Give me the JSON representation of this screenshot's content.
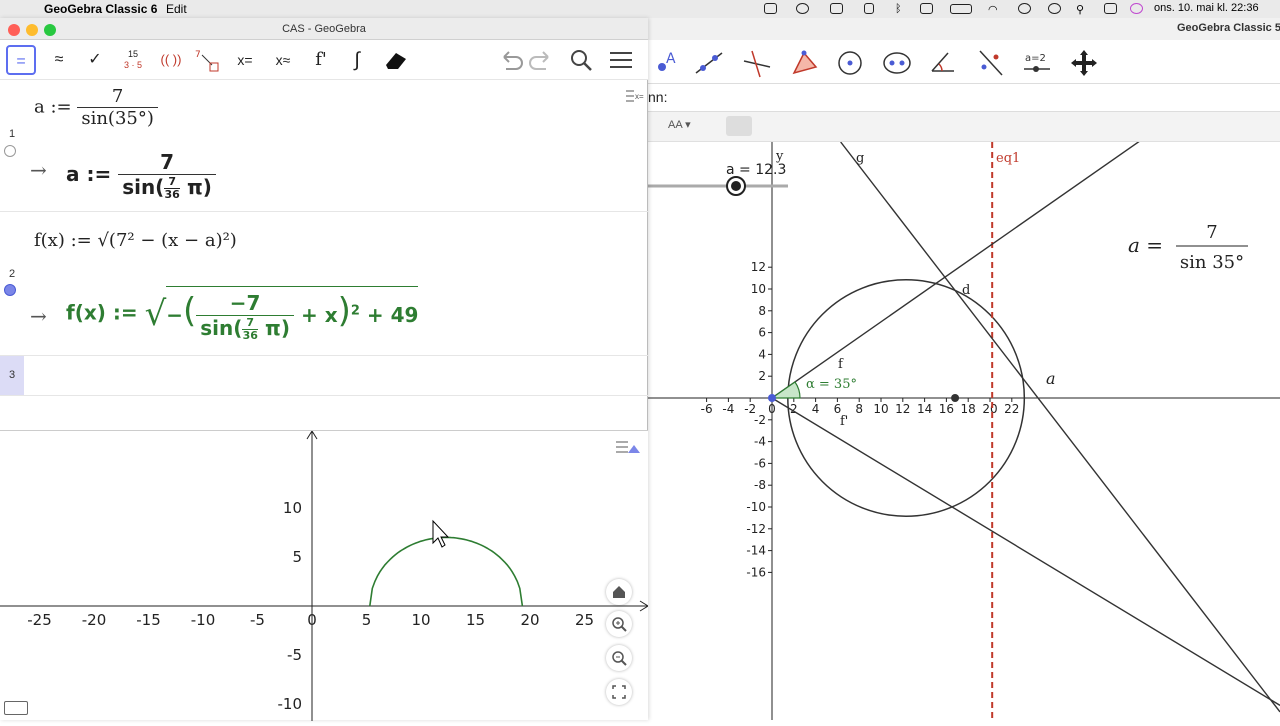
{
  "menubar": {
    "app": "GeoGebra Classic 6",
    "edit": "Edit",
    "clock": "ons. 10. mai kl. 22:36"
  },
  "geogebra_main": {
    "title": "GeoGebra Classic 5",
    "input_label": "nn:",
    "slider": {
      "label": "a = 12.3",
      "value": 12.3
    },
    "labels": {
      "g": "g",
      "d": "d",
      "f": "f",
      "fprime": "f'",
      "eq1": "eq1",
      "a_point": "a",
      "y_axis": "y",
      "angle": "α = 35°",
      "formula_lhs": "a =",
      "formula_num": "7",
      "formula_den": "sin 35°"
    },
    "x_ticks": [
      "-6",
      "-4",
      "-2",
      "0",
      "2",
      "4",
      "6",
      "8",
      "10",
      "12",
      "14",
      "16",
      "18",
      "20",
      "22"
    ],
    "y_ticks": [
      "12",
      "10",
      "8",
      "6",
      "4",
      "2",
      "-2",
      "-4",
      "-6",
      "-8",
      "-10",
      "-12",
      "-14",
      "-16"
    ],
    "colors": {
      "circle": "#333333",
      "eq1": "#c0392b",
      "angle": "#2e7d32"
    }
  },
  "cas": {
    "title": "CAS - GeoGebra",
    "toolbar": [
      "=",
      "≈",
      "✓",
      "15 3·5",
      "(( ))",
      "x=",
      "x≈",
      "f'",
      "∫"
    ],
    "rows": [
      {
        "num": "1",
        "input": {
          "lhs": "a :=",
          "num": "7",
          "den": "sin(35°)"
        },
        "output": {
          "lhs": "a :=",
          "num": "7",
          "den_pre": "sin(",
          "den_frac_n": "7",
          "den_frac_d": "36",
          "den_post": "π)"
        }
      },
      {
        "num": "2",
        "input": {
          "text": "f(x) := √(7² − (x − a)²)"
        },
        "output": {
          "lhs": "f(x) :=",
          "num": "−7",
          "den_pre": "sin(",
          "den_frac_n": "7",
          "den_frac_d": "36",
          "den_post": "π)",
          "tail": "+ x",
          "exp": "2",
          "end": "+ 49"
        }
      },
      {
        "num": "3"
      }
    ]
  },
  "graphics2": {
    "x_ticks": [
      "-25",
      "-20",
      "-15",
      "-10",
      "-5",
      "0",
      "5",
      "10",
      "15",
      "20",
      "25"
    ],
    "y_ticks": [
      "10",
      "5",
      "-5",
      "-10"
    ]
  }
}
